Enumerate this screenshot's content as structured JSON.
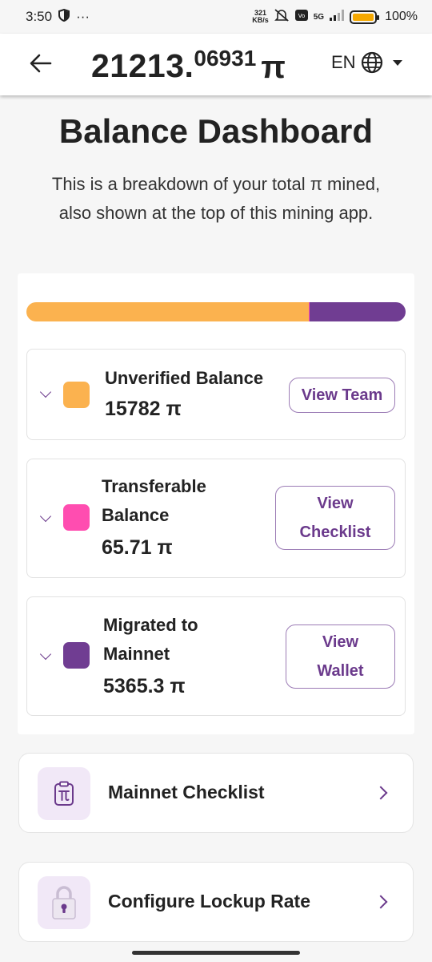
{
  "status": {
    "time": "3:50",
    "dots": "···",
    "net_speed_value": "321",
    "net_speed_unit": "KB/s",
    "network": "5G",
    "battery": "100%"
  },
  "header": {
    "balance_int": "21213.",
    "balance_dec": "06931",
    "pi": "π",
    "language": "EN"
  },
  "page": {
    "title": "Balance Dashboard",
    "description": "This is a breakdown of your total π mined, also shown at the top of this mining app."
  },
  "breakdown": {
    "total": 21213.07,
    "bar_fraction_unverified": 0.744,
    "bar_fraction_transferable": 0.003,
    "bar_fraction_migrated": 0.253,
    "rows": [
      {
        "label": "Unverified Balance",
        "value": "15782 π",
        "button": "View Team",
        "color": "#FBB24F"
      },
      {
        "label_line1": "Transferable",
        "label_line2": "Balance",
        "value": "65.71 π",
        "button_line1": "View",
        "button_line2": "Checklist",
        "color": "#FF4DB0"
      },
      {
        "label_line1": "Migrated to",
        "label_line2": "Mainnet",
        "value": "5365.3 π",
        "button_line1": "View",
        "button_line2": "Wallet",
        "color": "#703D92"
      }
    ]
  },
  "links": [
    {
      "label": "Mainnet Checklist",
      "icon": "pi-clipboard-icon"
    },
    {
      "label": "Configure Lockup Rate",
      "icon": "lock-icon"
    }
  ],
  "colors": {
    "accent": "#6B3A8C",
    "unverified": "#FBB24F",
    "transferable": "#FF4DB0",
    "migrated": "#703D92"
  }
}
